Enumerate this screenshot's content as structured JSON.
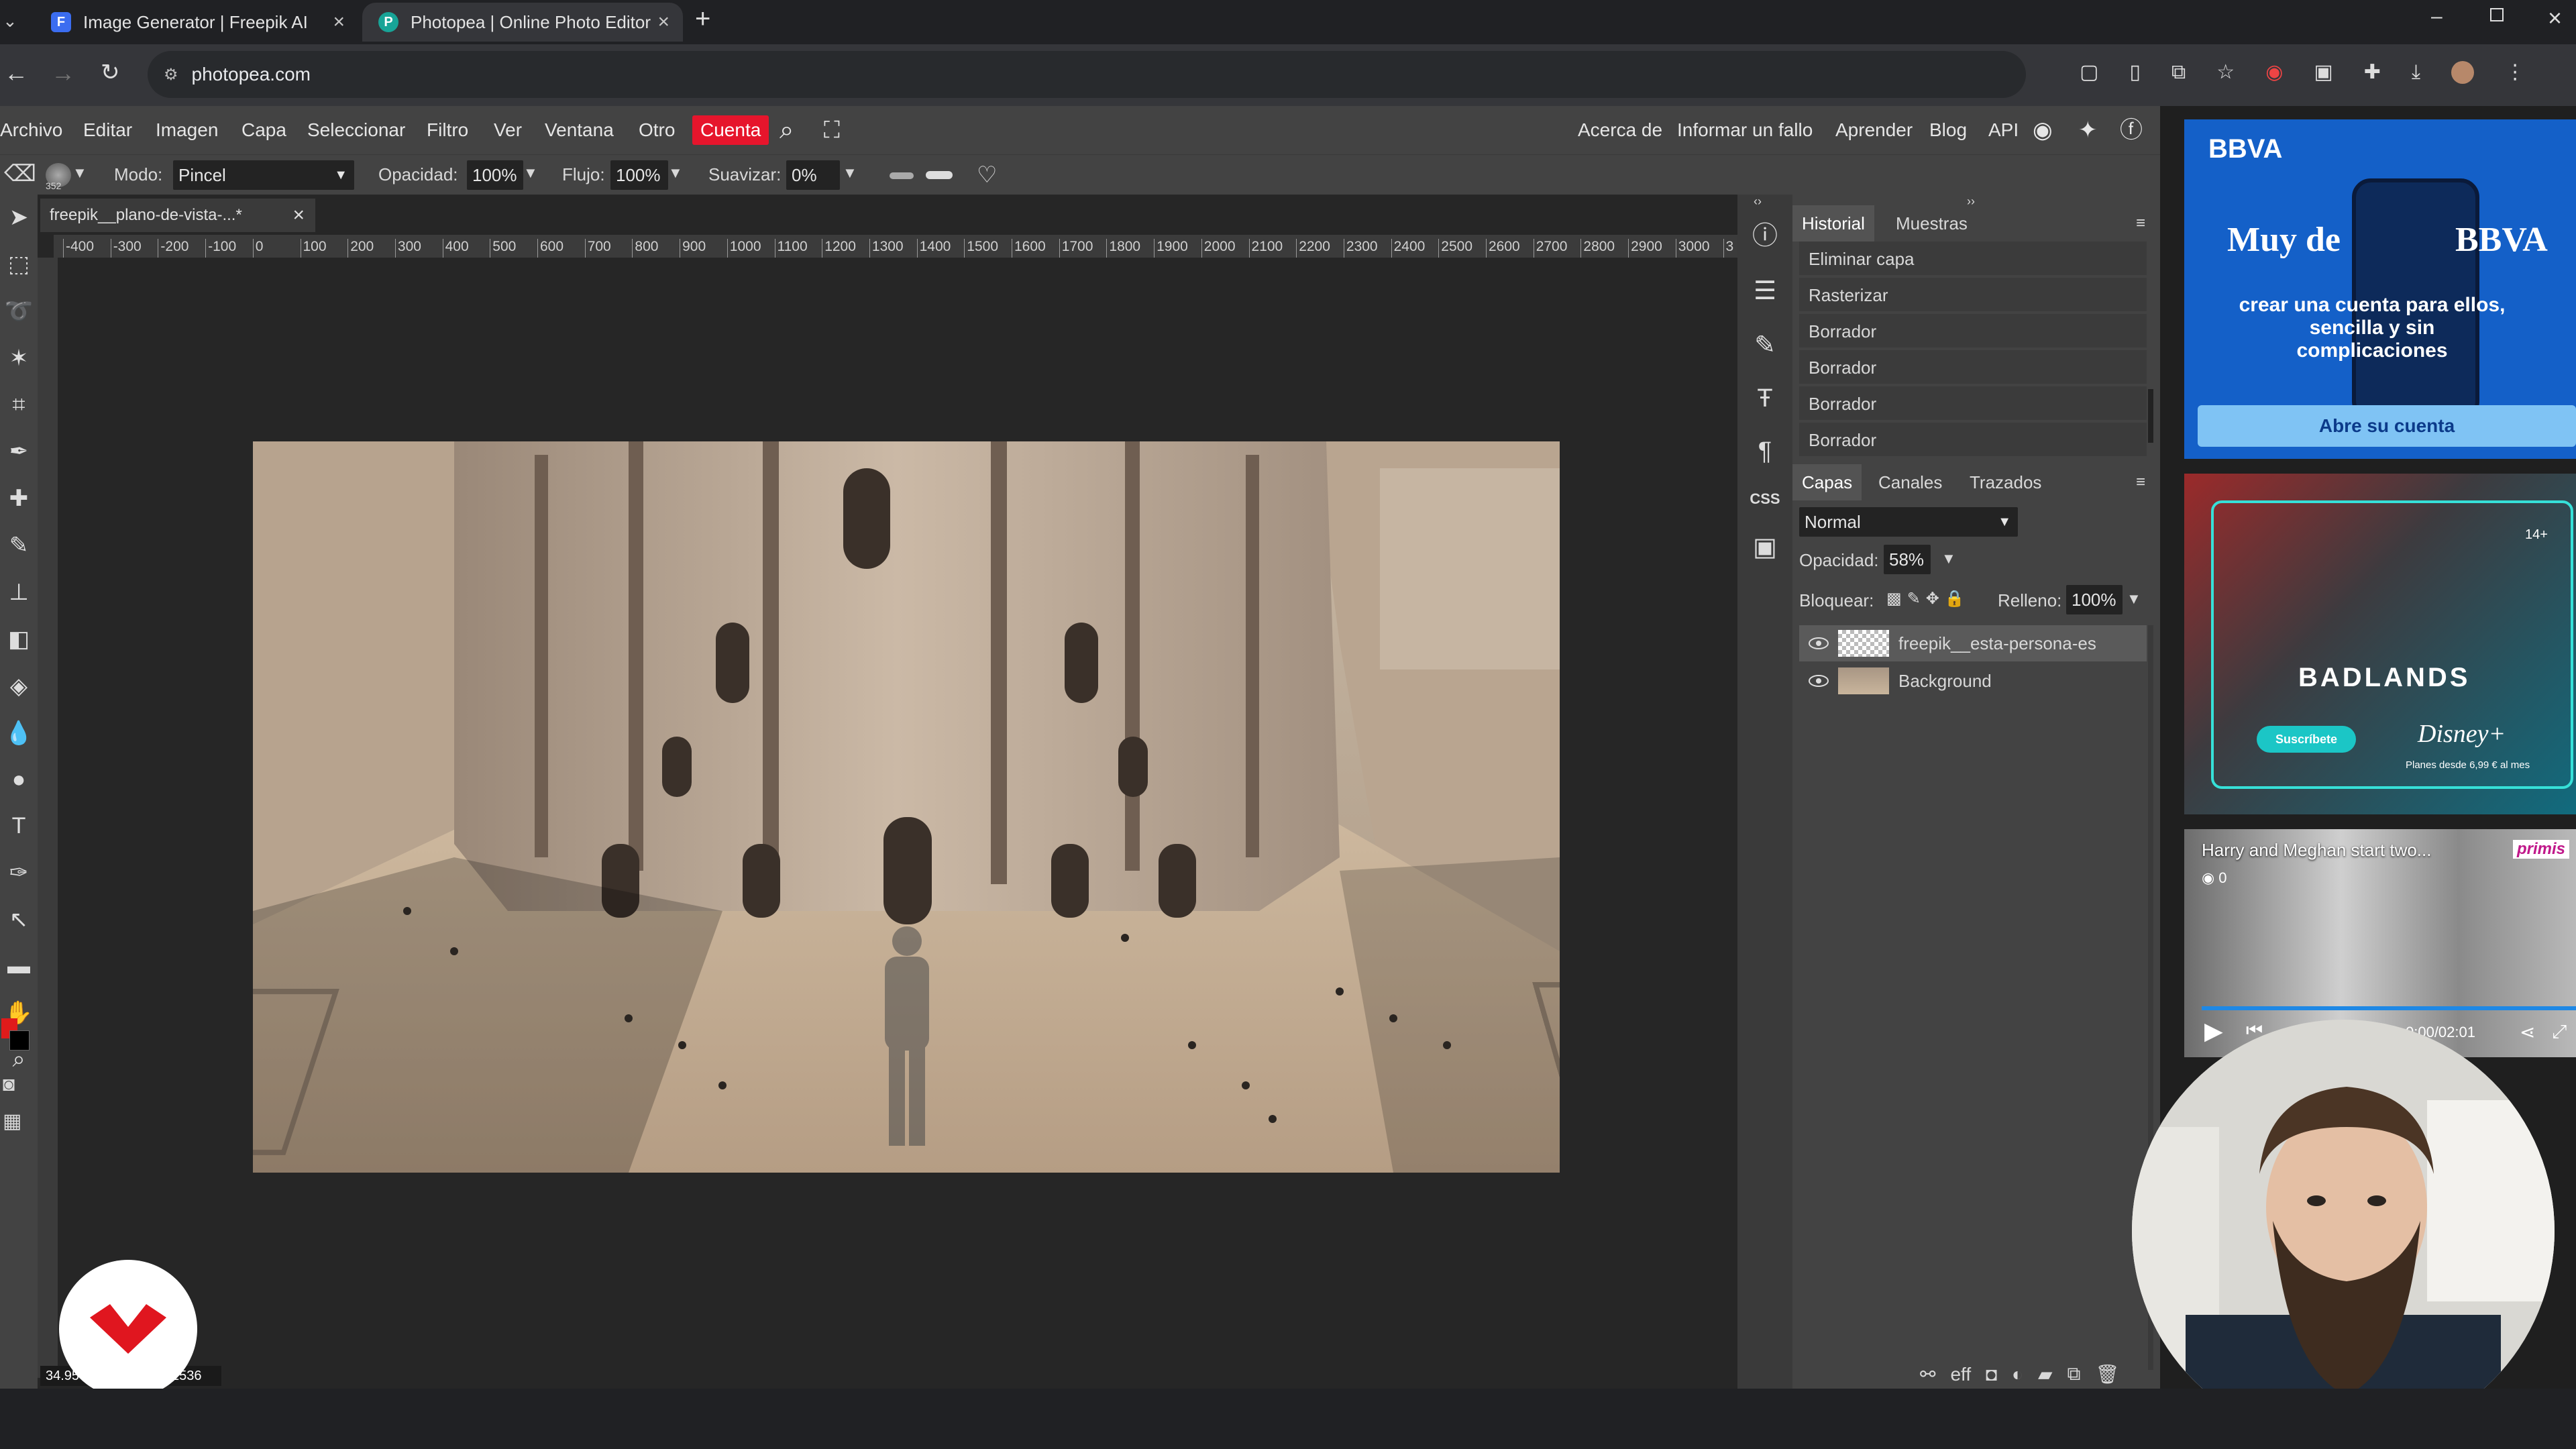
{
  "browser": {
    "tabs": [
      {
        "title": "Image Generator | Freepik AI",
        "active": false
      },
      {
        "title": "Photopea | Online Photo Editor",
        "active": true
      }
    ],
    "url": "photopea.com"
  },
  "menu": {
    "items": [
      "Archivo",
      "Editar",
      "Imagen",
      "Capa",
      "Seleccionar",
      "Filtro",
      "Ver",
      "Ventana",
      "Otro"
    ],
    "account": "Cuenta",
    "right_links": [
      "Acerca de",
      "Informar un fallo",
      "Aprender",
      "Blog",
      "API"
    ]
  },
  "options": {
    "brush_size": "352",
    "mode_label": "Modo:",
    "mode_value": "Pincel",
    "opacity_label": "Opacidad:",
    "opacity_value": "100%",
    "flow_label": "Flujo:",
    "flow_value": "100%",
    "smooth_label": "Suavizar:",
    "smooth_value": "0%"
  },
  "document": {
    "tab_title": "freepik__plano-de-vista-...*",
    "ruler_ticks": [
      "-400",
      "-300",
      "-200",
      "-100",
      "0",
      "100",
      "200",
      "300",
      "400",
      "500",
      "600",
      "700",
      "800",
      "900",
      "1000",
      "1100",
      "1200",
      "1300",
      "1400",
      "1500",
      "1600",
      "1700",
      "1800",
      "1900",
      "2000",
      "2100",
      "2200",
      "2300",
      "2400",
      "2500",
      "2600",
      "2700",
      "2800",
      "2900",
      "3000",
      "3"
    ],
    "zoom": "34.95",
    "dims": "1536"
  },
  "history": {
    "tabs": [
      "Historial",
      "Muestras"
    ],
    "items": [
      "Eliminar capa",
      "Rasterizar",
      "Borrador",
      "Borrador",
      "Borrador",
      "Borrador"
    ]
  },
  "layers": {
    "tabs": [
      "Capas",
      "Canales",
      "Trazados"
    ],
    "blend_mode": "Normal",
    "opacity_label": "Opacidad:",
    "opacity_value": "58%",
    "lock_label": "Bloquear:",
    "fill_label": "Relleno:",
    "fill_value": "100%",
    "items": [
      {
        "name": "freepik__esta-persona-es",
        "visible": true,
        "selected": true
      },
      {
        "name": "Background",
        "visible": true,
        "selected": false
      }
    ],
    "footer_effects": "eff"
  },
  "side_icons": {
    "css_label": "CSS"
  },
  "ads": {
    "bbva": {
      "brand": "BBVA",
      "headline_left": "Muy de",
      "headline_right": "BBVA",
      "body": "crear una cuenta para ellos, sencilla y sin complicaciones",
      "cta": "Abre su cuenta"
    },
    "disney": {
      "title": "BADLANDS",
      "brand": "Disney+",
      "cta": "Suscríbete",
      "rating": "14+",
      "price": "Planes desde 6,99 € al mes"
    },
    "video": {
      "title": "Harry and Meghan start two...",
      "brand": "primis",
      "views": "0",
      "time": "0:00/02:01"
    }
  },
  "colors": {
    "accent_red": "#e6152c",
    "panel_bg": "#434343",
    "doc_bg": "#262626"
  }
}
